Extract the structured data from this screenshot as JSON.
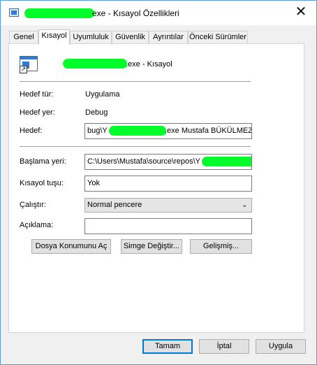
{
  "window": {
    "title_suffix": "exe - Kısayol Özellikleri",
    "close_label": "✕"
  },
  "tabs": [
    {
      "label": "Genel"
    },
    {
      "label": "Kısayol"
    },
    {
      "label": "Uyumluluk"
    },
    {
      "label": "Güvenlik"
    },
    {
      "label": "Ayrıntılar"
    },
    {
      "label": "Önceki Sürümler"
    }
  ],
  "active_tab": "Kısayol",
  "shortcut": {
    "name_suffix": ".exe - Kısayol",
    "target_type_label": "Hedef tür:",
    "target_type_value": "Uygulama",
    "target_location_label": "Hedef yer:",
    "target_location_value": "Debug",
    "target_label": "Hedef:",
    "target_value_left": "bug\\Y",
    "target_value_right": ".exe Mustafa BÜKÜLMEZ",
    "start_in_label": "Başlama yeri:",
    "start_in_value": "C:\\Users\\Mustafa\\source\\repos\\Y",
    "shortcut_key_label": "Kısayol tuşu:",
    "shortcut_key_value": "Yok",
    "run_label": "Çalıştır:",
    "run_value": "Normal pencere",
    "comment_label": "Açıklama:",
    "comment_value": ""
  },
  "actions": {
    "open_location": "Dosya Konumunu Aç",
    "change_icon": "Simge Değiştir...",
    "advanced": "Gelişmiş..."
  },
  "footer": {
    "ok": "Tamam",
    "cancel": "İptal",
    "apply": "Uygula"
  },
  "colors": {
    "redaction": "#00ff2a",
    "accent": "#0078d7"
  }
}
